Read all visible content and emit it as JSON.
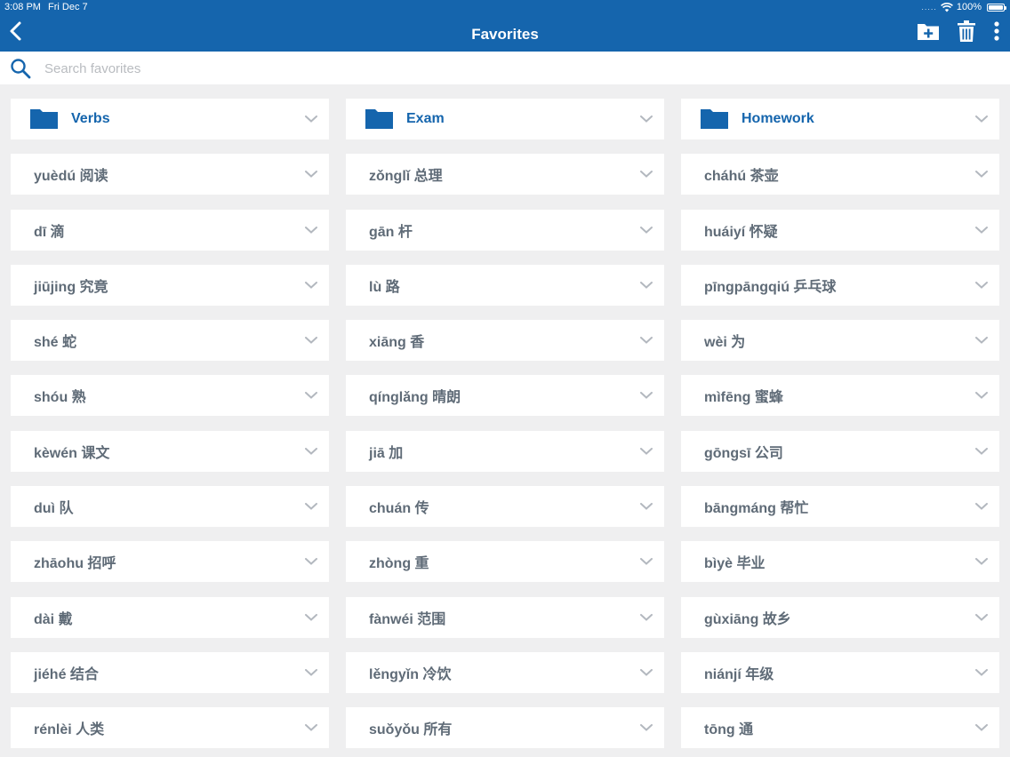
{
  "status_bar": {
    "time": "3:08 PM",
    "date": "Fri Dec 7",
    "signal": ".....",
    "battery": "100%"
  },
  "header": {
    "title": "Favorites"
  },
  "search": {
    "placeholder": "Search favorites"
  },
  "columns": [
    {
      "folder": "Verbs",
      "items": [
        "yuèdú 阅读",
        "dī 滴",
        "jiūjing 究竟",
        "shé 蛇",
        "shóu 熟",
        "kèwén 课文",
        "duì 队",
        "zhāohu 招呼",
        "dài 戴",
        "jiéhé 结合",
        "rénlèi 人类"
      ]
    },
    {
      "folder": "Exam",
      "items": [
        "zǒnglǐ 总理",
        "gān 杆",
        "lù 路",
        "xiāng 香",
        "qínglǎng 晴朗",
        "jiā 加",
        "chuán 传",
        "zhòng 重",
        "fànwéi 范围",
        "lěngyǐn 冷饮",
        "suǒyǒu 所有"
      ]
    },
    {
      "folder": "Homework",
      "items": [
        "cháhú 茶壶",
        "huáiyí 怀疑",
        "pīngpāngqiú 乒乓球",
        "wèi 为",
        "mìfēng 蜜蜂",
        "gōngsī 公司",
        "bāngmáng 帮忙",
        "bìyè 毕业",
        "gùxiāng 故乡",
        "niánjí 年级",
        "tōng 通"
      ]
    }
  ],
  "colors": {
    "brand": "#1565ad",
    "card_text": "#5f6b77",
    "background": "#efeff0",
    "chevron": "#b3b8bf"
  }
}
